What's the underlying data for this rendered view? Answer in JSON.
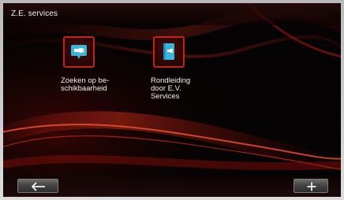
{
  "header": {
    "title": "Z.E. services"
  },
  "apps": [
    {
      "label_line1": "Zoeken op be-",
      "label_line2": "schikbaarheid",
      "icon": "charging-plug-icon"
    },
    {
      "label_line1": "Rondleiding",
      "label_line2": "door E.V.",
      "label_line3": "Services",
      "icon": "ev-guide-book-icon"
    }
  ],
  "footer": {
    "back_icon": "back-arrow-icon",
    "add_icon": "plus-icon"
  },
  "colors": {
    "accent_red": "#c2231d",
    "icon_blue": "#39b6de",
    "text": "#f2f2f2"
  }
}
